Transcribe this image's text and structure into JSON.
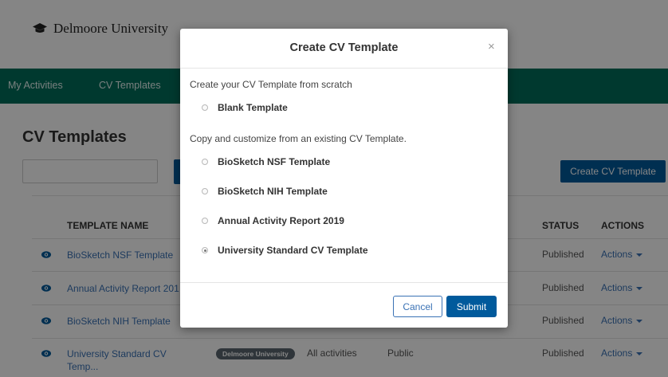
{
  "top_caption": "(",
  "header": {
    "university_name": "Delmoore University"
  },
  "nav": {
    "items": [
      "My Activities",
      "CV Templates"
    ]
  },
  "page": {
    "title": "CV Templates"
  },
  "search": {
    "placeholder": ""
  },
  "toolbar": {
    "create_label": "Create CV Template"
  },
  "table": {
    "headers": {
      "name": "TEMPLATE NAME",
      "status": "STATUS",
      "actions": "ACTIONS"
    },
    "rows": [
      {
        "name": "BioSketch NSF Template",
        "status": "Published",
        "actions": "Actions"
      },
      {
        "name": "Annual Activity Report 201",
        "status": "Published",
        "actions": "Actions"
      },
      {
        "name": "BioSketch NIH Template",
        "status": "Published",
        "actions": "Actions"
      },
      {
        "name": "University Standard CV Temp...",
        "badge": "Delmoore University",
        "scope": "All activities",
        "visibility": "Public",
        "status": "Published",
        "actions": "Actions"
      }
    ]
  },
  "modal": {
    "title": "Create CV Template",
    "close": "×",
    "scratch_label": "Create your CV Template from scratch",
    "copy_label": "Copy and customize from an existing CV Template.",
    "options": [
      {
        "label": "Blank Template",
        "checked": false
      },
      {
        "label": "BioSketch NSF Template",
        "checked": false
      },
      {
        "label": "BioSketch NIH Template",
        "checked": false
      },
      {
        "label": "Annual Activity Report 2019",
        "checked": false
      },
      {
        "label": "University Standard CV Template",
        "checked": true
      }
    ],
    "cancel_label": "Cancel",
    "submit_label": "Submit"
  },
  "colors": {
    "nav_bg": "#006d5b",
    "primary": "#005a9c",
    "link": "#3a72b5"
  }
}
